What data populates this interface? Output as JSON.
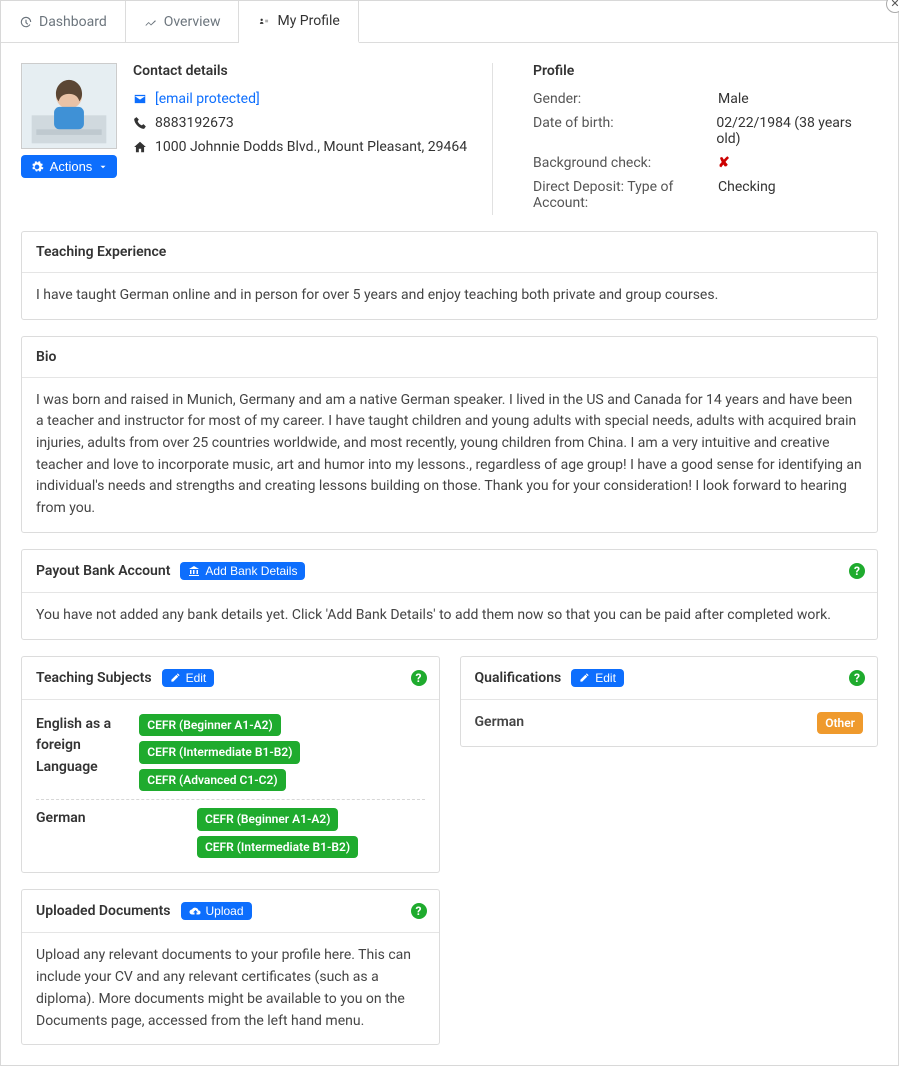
{
  "close_label": "✕",
  "tabs": [
    {
      "label": "Dashboard"
    },
    {
      "label": "Overview"
    },
    {
      "label": "My Profile"
    }
  ],
  "actions_label": "Actions",
  "contact": {
    "heading": "Contact details",
    "email": "[email protected]",
    "phone": "8883192673",
    "address": "1000 Johnnie Dodds Blvd., Mount Pleasant, 29464"
  },
  "profile": {
    "heading": "Profile",
    "gender_label": "Gender:",
    "gender_value": "Male",
    "dob_label": "Date of birth:",
    "dob_value": "02/22/1984 (38 years old)",
    "bg_label": "Background check:",
    "bg_value": "✘",
    "dd_label": "Direct Deposit: Type of Account:",
    "dd_value": "Checking"
  },
  "teaching_experience": {
    "heading": "Teaching Experience",
    "body": "I have taught German online and in person for over 5 years and enjoy teaching both private and group courses."
  },
  "bio": {
    "heading": "Bio",
    "body": "I was born and raised in Munich, Germany and am a native German speaker. I lived in the US and Canada for 14 years and have been a teacher and instructor for most of my career. I have taught children and young adults with special needs, adults with acquired brain injuries, adults from over 25 countries worldwide, and most recently, young children from China. I am a very intuitive and creative teacher and love to incorporate music, art and humor into my lessons., regardless of age group! I have a good sense for identifying an individual's needs and strengths and creating lessons building on those. Thank you for your consideration! I look forward to hearing from you."
  },
  "payout": {
    "heading": "Payout Bank Account",
    "button": "Add Bank Details",
    "body": "You have not added any bank details yet. Click 'Add Bank Details' to add them now so that you can be paid after completed work."
  },
  "subjects": {
    "heading": "Teaching Subjects",
    "edit": "Edit",
    "rows": [
      {
        "name": "English as a foreign Language",
        "levels": [
          "CEFR (Beginner A1-A2)",
          "CEFR (Intermediate B1-B2)",
          "CEFR (Advanced C1-C2)"
        ]
      },
      {
        "name": "German",
        "levels": [
          "CEFR (Beginner A1-A2)",
          "CEFR (Intermediate B1-B2)"
        ]
      }
    ]
  },
  "qualifications": {
    "heading": "Qualifications",
    "edit": "Edit",
    "rows": [
      {
        "name": "German",
        "tag": "Other"
      }
    ]
  },
  "documents": {
    "heading": "Uploaded Documents",
    "upload": "Upload",
    "body": "Upload any relevant documents to your profile here. This can include your CV and any relevant certificates (such as a diploma). More documents might be available to you on the Documents page, accessed from the left hand menu."
  },
  "help_tooltip": "?"
}
